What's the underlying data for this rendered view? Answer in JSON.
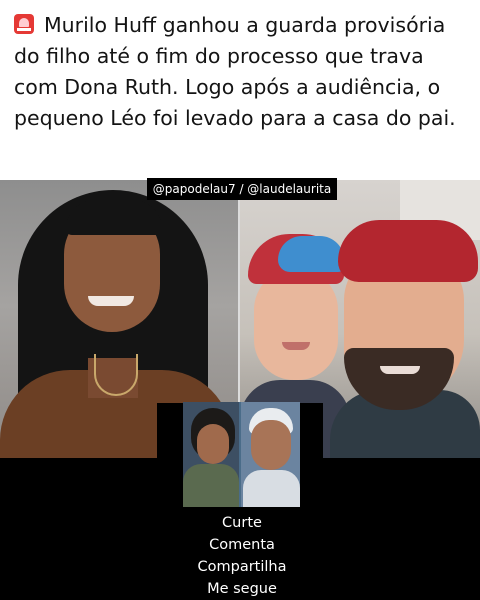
{
  "post": {
    "icon": "police-siren-icon",
    "text": "Murilo Huff ganhou a guarda provisória do filho até o fim do processo que trava com Dona Ruth. Logo após a audiência, o pequeno Léo foi levado para a casa do pai."
  },
  "image": {
    "handle_tag": "@papodelau7 / @laudelaurita"
  },
  "call_to_action": {
    "line1": "Curte",
    "line2": "Comenta",
    "line3": "Compartilha",
    "line4": "Me segue"
  },
  "colors": {
    "siren": "#e53935",
    "text": "#141414",
    "overlay_background": "#000000",
    "overlay_text": "#ffffff"
  }
}
